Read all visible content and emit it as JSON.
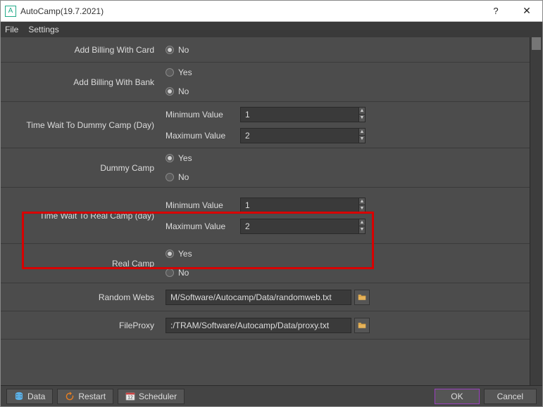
{
  "window": {
    "title": "AutoCamp(19.7.2021)"
  },
  "menubar": {
    "file": "File",
    "settings": "Settings"
  },
  "labels": {
    "yes": "Yes",
    "no": "No",
    "min": "Minimum Value",
    "max": "Maximum Value"
  },
  "rows": {
    "addBillingCard": {
      "label": "Add Billing With Card",
      "selected": "no"
    },
    "addBillingBank": {
      "label": "Add Billing With Bank",
      "selected": "no"
    },
    "timeWaitDummy": {
      "label": "Time Wait To Dummy Camp (Day)",
      "min": "1",
      "max": "2"
    },
    "dummyCamp": {
      "label": "Dummy Camp",
      "selected": "yes"
    },
    "timeWaitReal": {
      "label": "Time Wait To Real Camp (day)",
      "min": "1",
      "max": "2"
    },
    "realCamp": {
      "label": "Real Camp",
      "selected": "yes"
    },
    "randomWebs": {
      "label": "Random Webs",
      "value": "M/Software/Autocamp/Data/randomweb.txt"
    },
    "fileProxy": {
      "label": "FileProxy",
      "value": ":/TRAM/Software/Autocamp/Data/proxy.txt"
    }
  },
  "footer": {
    "data": "Data",
    "restart": "Restart",
    "scheduler": "Scheduler",
    "ok": "OK",
    "cancel": "Cancel"
  }
}
